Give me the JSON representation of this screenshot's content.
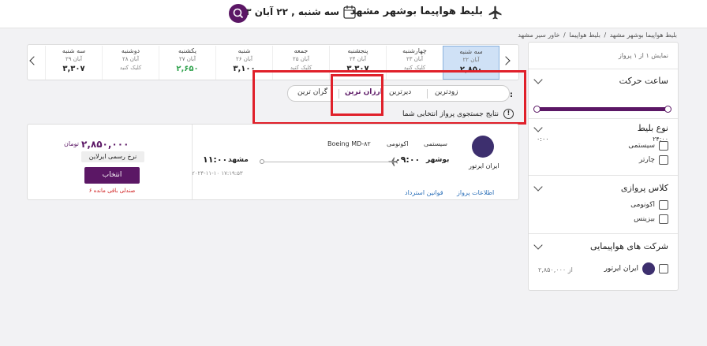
{
  "header": {
    "title": "بلیط هواپیما بوشهر مشهد",
    "date": "سه شنبه , ۲۲ آبان ۱۴۰۳"
  },
  "breadcrumb": [
    "خاور سیر مشهد",
    "بلیط هواپیما",
    "بلیط هواپیما بوشهر مشهد"
  ],
  "sidebar": {
    "count": "نمایش ۱ از ۱ پرواز",
    "departure": {
      "title": "ساعت حرکت",
      "from": "۰:۰۰",
      "to": "۲۴:۰۰"
    },
    "ticket_type": {
      "title": "نوع بلیط",
      "options": [
        "سیستمی",
        "چارتر"
      ]
    },
    "cabin": {
      "title": "کلاس پروازی",
      "options": [
        "اکونومی",
        "بیزینس"
      ]
    },
    "airlines": {
      "title": "شرکت های هواپیمایی",
      "name": "ایران ایرتور",
      "price": "از ۲,۸۵۰,۰۰۰"
    }
  },
  "dates": [
    {
      "day": "سه شنبه",
      "date": "۲۲ آبان",
      "price": "۲,۸۵۰",
      "selected": true
    },
    {
      "day": "چهارشنبه",
      "date": "۲۳ آبان",
      "price": "کلیک کنید"
    },
    {
      "day": "پنجشنبه",
      "date": "۲۴ آبان",
      "price": "۳,۳۰۷"
    },
    {
      "day": "جمعه",
      "date": "۲۵ آبان",
      "price": "کلیک کنید"
    },
    {
      "day": "شنبه",
      "date": "۲۶ آبان",
      "price": "۳,۱۰۰"
    },
    {
      "day": "یکشنبه",
      "date": "۲۷ آبان",
      "price": "۲,۶۵۰",
      "green": true
    },
    {
      "day": "دوشنبه",
      "date": "۲۸ آبان",
      "price": "کلیک کنید"
    },
    {
      "day": "سه شنبه",
      "date": "۲۹ آبان",
      "price": "۳,۳۰۷"
    }
  ],
  "sort": {
    "label": "مرتب سازی :",
    "options": [
      "زودترین",
      "دیرترین",
      "ارزان ترین",
      "گران ترین"
    ],
    "active": "ارزان ترین"
  },
  "info": "نتایج جستجوی پرواز انتخابی شما",
  "flight": {
    "airline": "ایران ایرتور",
    "type": "سیستمی",
    "cabin": "اکونومی",
    "aircraft": "Boeing MD-۸۲",
    "origin": "بوشهر",
    "dep_time": "۰۹:۰۰",
    "destination": "مشهد",
    "arr_time": "۱۱:۰۰",
    "stamp": "۲۰۲۴-۱۱-۱۰ ۱۷:۱۹:۵۳",
    "links": [
      "اطلاعات پرواز",
      "قوانین استرداد"
    ],
    "price": "۲,۸۵۰,۰۰۰",
    "currency": "تومان",
    "fare_badge": "نرخ رسمی ایرلاین",
    "select": "انتخاب",
    "seats": "۶ صندلی باقی مانده"
  }
}
